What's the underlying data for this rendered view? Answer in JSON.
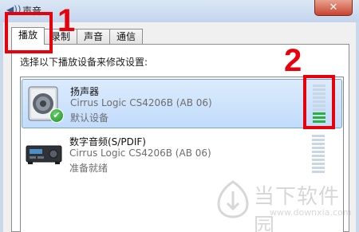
{
  "window": {
    "title": "声音",
    "close_label": "✕"
  },
  "tabs": [
    {
      "label": "播放",
      "active": true
    },
    {
      "label": "录制",
      "active": false
    },
    {
      "label": "声音",
      "active": false
    },
    {
      "label": "通信",
      "active": false
    }
  ],
  "instruction": "选择以下播放设备来修改设置:",
  "devices": [
    {
      "name": "扬声器",
      "driver": "Cirrus Logic CS4206B (AB 06)",
      "status": "默认设备",
      "icon": "speaker-icon",
      "selected": true,
      "default_badge": "check-icon",
      "level_segments_total": 10,
      "level_segments_on": 3
    },
    {
      "name": "数字音频(S/PDIF)",
      "driver": "Cirrus Logic CS4206B (AB 06)",
      "status": "准备就绪",
      "icon": "digital-audio-receiver-icon",
      "selected": false,
      "level_segments_total": 10,
      "level_segments_on": 0
    }
  ],
  "annotations": [
    {
      "number": "1",
      "target": "tab-playback"
    },
    {
      "number": "2",
      "target": "volume-meter-speakers"
    }
  ],
  "watermark": {
    "name": "当下软件园",
    "url": "www.downxia.com"
  },
  "colors": {
    "annotation": "#e8000b",
    "meter_on": "#2fae3d",
    "meter_off": "#c9d6e3",
    "selection": "#c1dcfc"
  }
}
